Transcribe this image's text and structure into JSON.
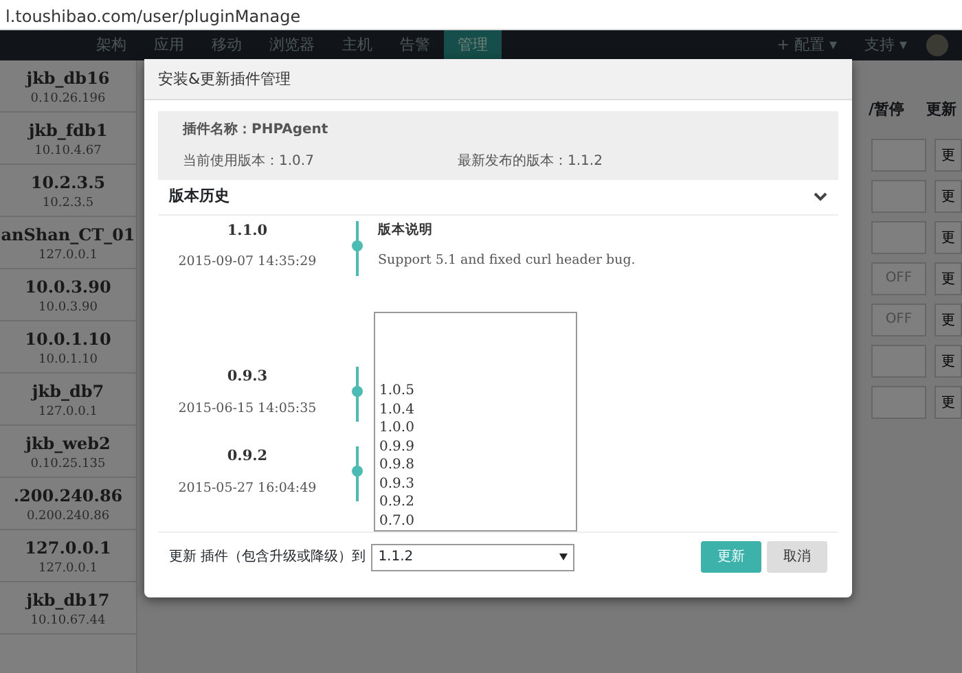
{
  "address_bar": {
    "url": "l.toushibao.com/user/pluginManage"
  },
  "navbar": {
    "items": [
      {
        "label": "架构",
        "selected": false
      },
      {
        "label": "应用",
        "selected": false
      },
      {
        "label": "移动",
        "selected": false
      },
      {
        "label": "浏览器",
        "selected": false
      },
      {
        "label": "主机",
        "selected": false
      },
      {
        "label": "告警",
        "selected": false
      },
      {
        "label": "管理",
        "selected": true
      }
    ],
    "right_menus": [
      "+ 配置 ▾",
      "支持 ▾"
    ]
  },
  "sidebar": {
    "items": [
      {
        "name": "jkb_db16",
        "address": "0.10.26.196"
      },
      {
        "name": "jkb_fdb1",
        "address": "10.10.4.67"
      },
      {
        "name": "10.2.3.5",
        "address": "10.2.3.5"
      },
      {
        "name": "anShan_CT_01",
        "address": "127.0.0.1"
      },
      {
        "name": "10.0.3.90",
        "address": "10.0.3.90"
      },
      {
        "name": "10.0.1.10",
        "address": "10.0.1.10"
      },
      {
        "name": "jkb_db7",
        "address": "127.0.0.1"
      },
      {
        "name": "jkb_web2",
        "address": "0.10.25.135"
      },
      {
        "name": ".200.240.86",
        "address": "0.200.240.86"
      },
      {
        "name": "127.0.0.1",
        "address": "127.0.0.1"
      },
      {
        "name": "jkb_db17",
        "address": "10.10.67.44"
      }
    ]
  },
  "table": {
    "columns": [
      "/暂停",
      "更新"
    ],
    "rows": [
      {
        "action": "更"
      },
      {
        "action": "更"
      },
      {
        "action": "更"
      },
      {
        "state": "OFF",
        "action": "更"
      },
      {
        "state": "OFF",
        "action": "更"
      },
      {
        "action": "更"
      },
      {
        "action": "更"
      }
    ]
  },
  "dialog": {
    "title": "安装&更新插件管理",
    "plugin_name": "插件名称：PHPAgent",
    "current_version": "当前使用版本：1.0.7",
    "latest_version": "最新发布的版本：1.1.2",
    "history": {
      "title": "版本历史",
      "expanded": true,
      "entries": [
        {
          "version": "1.1.0",
          "date": "2015-09-07 14:35:29",
          "notes_title": "版本说明",
          "notes": "Support 5.1 and fixed curl header bug."
        },
        {
          "version": "0.9.3",
          "date": "2015-06-15 14:05:35"
        },
        {
          "version": "0.9.2",
          "date": "2015-05-27 16:04:49"
        }
      ]
    },
    "update_label": "更新 插件（包含升级或降级）到",
    "version_select": {
      "value": "1.1.2",
      "expanded": true,
      "options": [
        "1.0.5",
        "1.0.4",
        "1.0.0",
        "0.9.9",
        "0.9.8",
        "0.9.3",
        "0.9.2",
        "0.7.0"
      ]
    },
    "buttons": [
      {
        "label": "更新",
        "kind": "primary"
      },
      {
        "label": "取消",
        "kind": "secondary"
      }
    ]
  }
}
